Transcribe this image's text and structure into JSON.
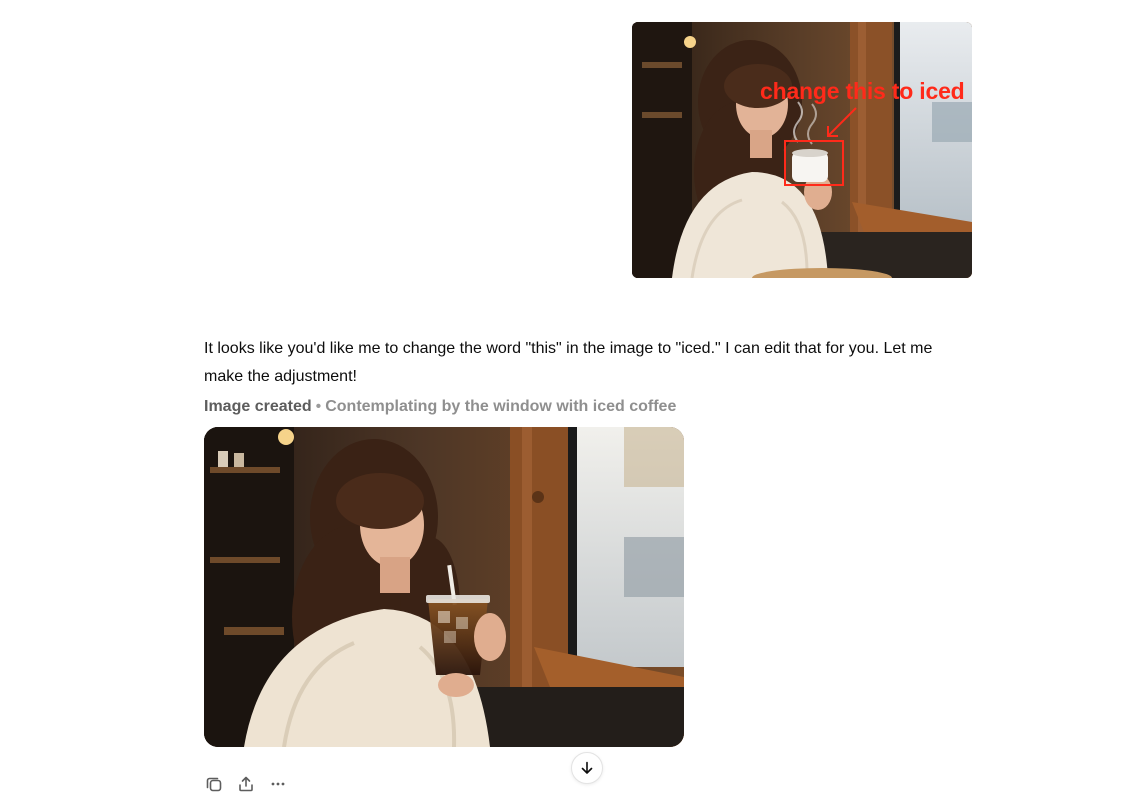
{
  "user_message": {
    "image": {
      "description_icon": "uploaded-image",
      "annotation_label": "change this to iced",
      "annotation_color": "#ff2a1a"
    }
  },
  "assistant_message": {
    "text": "It looks like you'd like me to change the word \"this\" in the image to \"iced.\" I can edit that for you. Let me make the adjustment!",
    "image_status": {
      "label": "Image created",
      "separator": "•",
      "caption": "Contemplating by the window with iced coffee"
    }
  },
  "actions": {
    "copy_icon": "copy-icon",
    "share_icon": "share-icon",
    "more_icon": "more-icon"
  },
  "scroll_button": {
    "icon": "arrow-down-icon"
  }
}
